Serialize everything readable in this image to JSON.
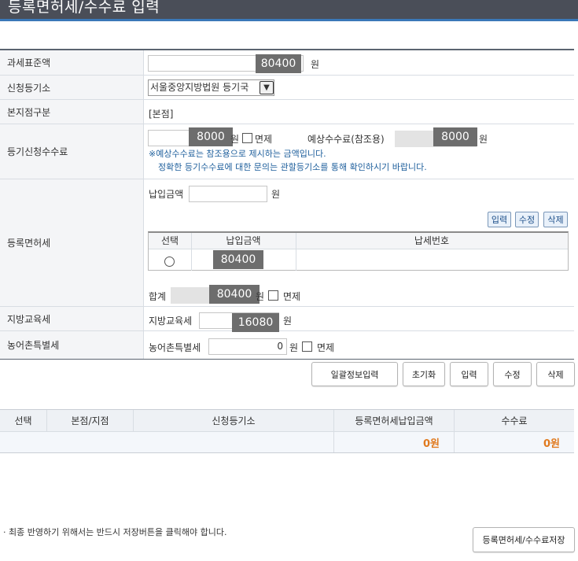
{
  "title": "등록면허세/수수료 입력",
  "unit_won": "원",
  "rows": {
    "tax_base": {
      "label": "과세표준액",
      "overlay": "80400",
      "unit": "원"
    },
    "registry": {
      "label": "신청등기소",
      "selected": "서울중앙지방법원 등기국"
    },
    "branch": {
      "label": "본지점구분",
      "value": "[본점]"
    },
    "reg_fee": {
      "label": "등기신청수수료",
      "overlay": "8000",
      "unit": "원",
      "exempt_label": "면제",
      "expected_label": "예상수수료(참조용)",
      "expected_overlay": "8000",
      "expected_unit": "원",
      "note1": "※예상수수료는 참조용으로 제시하는 금액입니다.",
      "note2": "정확한 등기수수료에 대한 문의는 관할등기소를 통해 확인하시기 바랍니다."
    },
    "license_tax": {
      "label": "등록면허세",
      "pay_label": "납입금액",
      "pay_unit": "원",
      "btn_input": "입력",
      "btn_edit": "수정",
      "btn_delete": "삭제",
      "table_headers": [
        "선택",
        "납입금액",
        "납세번호"
      ],
      "table_row_amount": "80400",
      "total_label": "합계",
      "total_overlay": "80400",
      "total_unit": "원",
      "exempt_label": "면제"
    },
    "edu_tax": {
      "label": "지방교육세",
      "field_label": "지방교육세",
      "overlay": "16080",
      "unit": "원"
    },
    "rural_tax": {
      "label": "농어촌특별세",
      "field_label": "농어촌특별세",
      "value": "0",
      "unit": "원",
      "exempt_label": "면제"
    }
  },
  "actions": {
    "batch": "일괄정보입력",
    "reset": "초기화",
    "input": "입력",
    "edit": "수정",
    "delete": "삭제"
  },
  "summary": {
    "headers": [
      "선택",
      "본점/지점",
      "신청등기소",
      "등록면허세납입금액",
      "수수료"
    ],
    "license_amount": "0원",
    "fee_amount": "0원"
  },
  "footer": {
    "note": "· 최종 반영하기 위해서는 반드시 저장버튼을 클릭해야 합니다.",
    "save": "등록면허세/수수료저장"
  },
  "colors": {
    "title_bg": "#4a4e58",
    "accent": "#3a78b8",
    "amount": "#e07a1f"
  }
}
